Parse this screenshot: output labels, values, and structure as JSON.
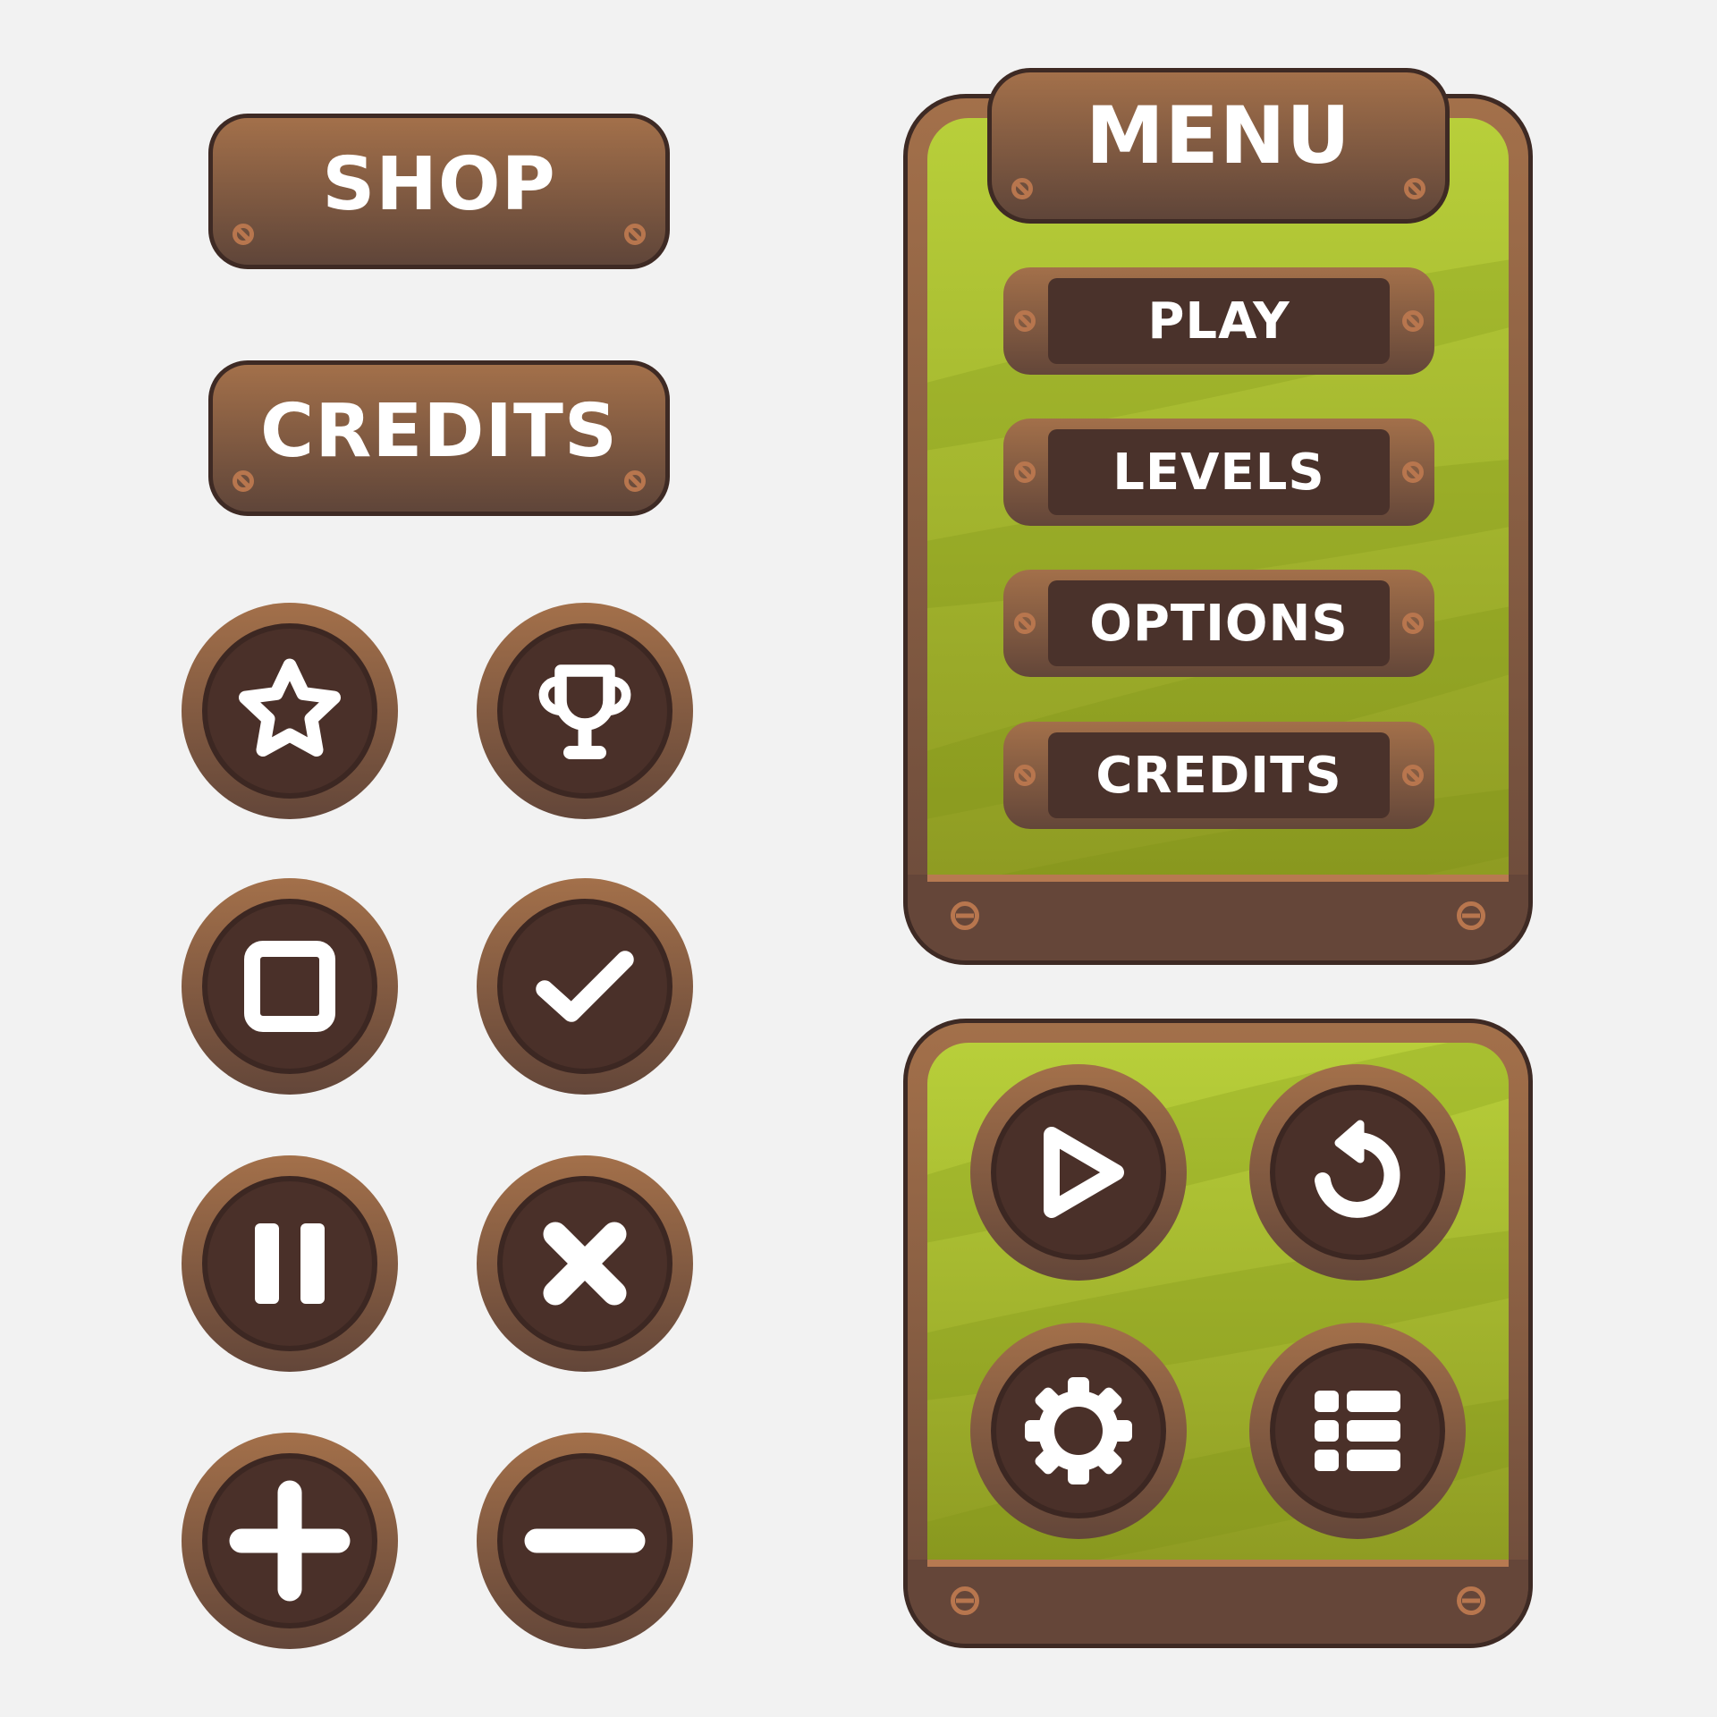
{
  "left_buttons": {
    "shop_label": "SHOP",
    "credits_label": "CREDITS"
  },
  "icon_buttons": [
    {
      "icon": "star-icon"
    },
    {
      "icon": "trophy-icon"
    },
    {
      "icon": "stop-square-icon"
    },
    {
      "icon": "checkmark-icon"
    },
    {
      "icon": "pause-icon"
    },
    {
      "icon": "close-x-icon"
    },
    {
      "icon": "plus-icon"
    },
    {
      "icon": "minus-icon"
    }
  ],
  "menu_panel": {
    "title": "MENU",
    "items": [
      {
        "label": "PLAY"
      },
      {
        "label": "LEVELS"
      },
      {
        "label": "OPTIONS"
      },
      {
        "label": "CREDITS"
      }
    ]
  },
  "control_panel": {
    "buttons": [
      {
        "icon": "play-icon"
      },
      {
        "icon": "restart-icon"
      },
      {
        "icon": "settings-gear-icon"
      },
      {
        "icon": "list-menu-icon"
      }
    ]
  },
  "colors": {
    "background": "#f2f2f2",
    "wood_light": "#a3704a",
    "wood_dark": "#5f4539",
    "outline": "#3e2a24",
    "inner_dark": "#4a3029",
    "grass_light": "#b8cf3a",
    "grass_dark": "#8e9b22",
    "screw": "#b8764e",
    "text": "#ffffff"
  }
}
